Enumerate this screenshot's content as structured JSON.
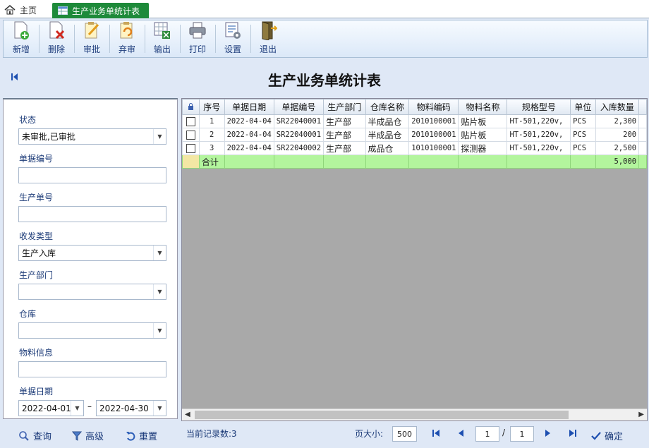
{
  "tabs": {
    "home": "主页",
    "active": "生产业务单统计表"
  },
  "toolbar": [
    {
      "label": "新增",
      "icon": "add-doc-icon"
    },
    {
      "label": "删除",
      "icon": "delete-doc-icon"
    },
    {
      "label": "审批",
      "icon": "approve-icon"
    },
    {
      "label": "弃审",
      "icon": "unapprove-icon"
    },
    {
      "label": "输出",
      "icon": "export-excel-icon"
    },
    {
      "label": "打印",
      "icon": "printer-icon"
    },
    {
      "label": "设置",
      "icon": "settings-icon"
    },
    {
      "label": "退出",
      "icon": "exit-door-icon"
    }
  ],
  "page_title": "生产业务单统计表",
  "filters": {
    "status": {
      "label": "状态",
      "value": "未审批,已审批"
    },
    "doc_no": {
      "label": "单据编号",
      "value": ""
    },
    "prod_no": {
      "label": "生产单号",
      "value": ""
    },
    "io_type": {
      "label": "收发类型",
      "value": "生产入库"
    },
    "dept": {
      "label": "生产部门",
      "value": ""
    },
    "warehouse": {
      "label": "仓库",
      "value": ""
    },
    "material": {
      "label": "物料信息",
      "value": ""
    },
    "date": {
      "label": "单据日期",
      "from": "2022-04-01",
      "sep": "–",
      "to": "2022-04-30"
    }
  },
  "grid": {
    "columns": [
      "序号",
      "单据日期",
      "单据编号",
      "生产部门",
      "仓库名称",
      "物料编码",
      "物料名称",
      "规格型号",
      "单位",
      "入库数量"
    ],
    "rows": [
      [
        "1",
        "2022-04-04",
        "SR22040001",
        "生产部",
        "半成品仓",
        "2010100001",
        "贴片板",
        "HT-501,220v,",
        "PCS",
        "2,300"
      ],
      [
        "2",
        "2022-04-04",
        "SR22040001",
        "生产部",
        "半成品仓",
        "2010100001",
        "贴片板",
        "HT-501,220v,",
        "PCS",
        "200"
      ],
      [
        "3",
        "2022-04-04",
        "SR22040002",
        "生产部",
        "成品仓",
        "1010100001",
        "探测器",
        "HT-501,220v,",
        "PCS",
        "2,500"
      ]
    ],
    "total_label": "合计",
    "total_qty": "5,000"
  },
  "bottom": {
    "query": "查询",
    "advanced": "高级",
    "reset": "重置",
    "record_count": "当前记录数:3",
    "page_size_label": "页大小:",
    "page_size": "500",
    "current_page": "1",
    "page_sep": "/",
    "total_pages": "1",
    "confirm": "确定"
  }
}
